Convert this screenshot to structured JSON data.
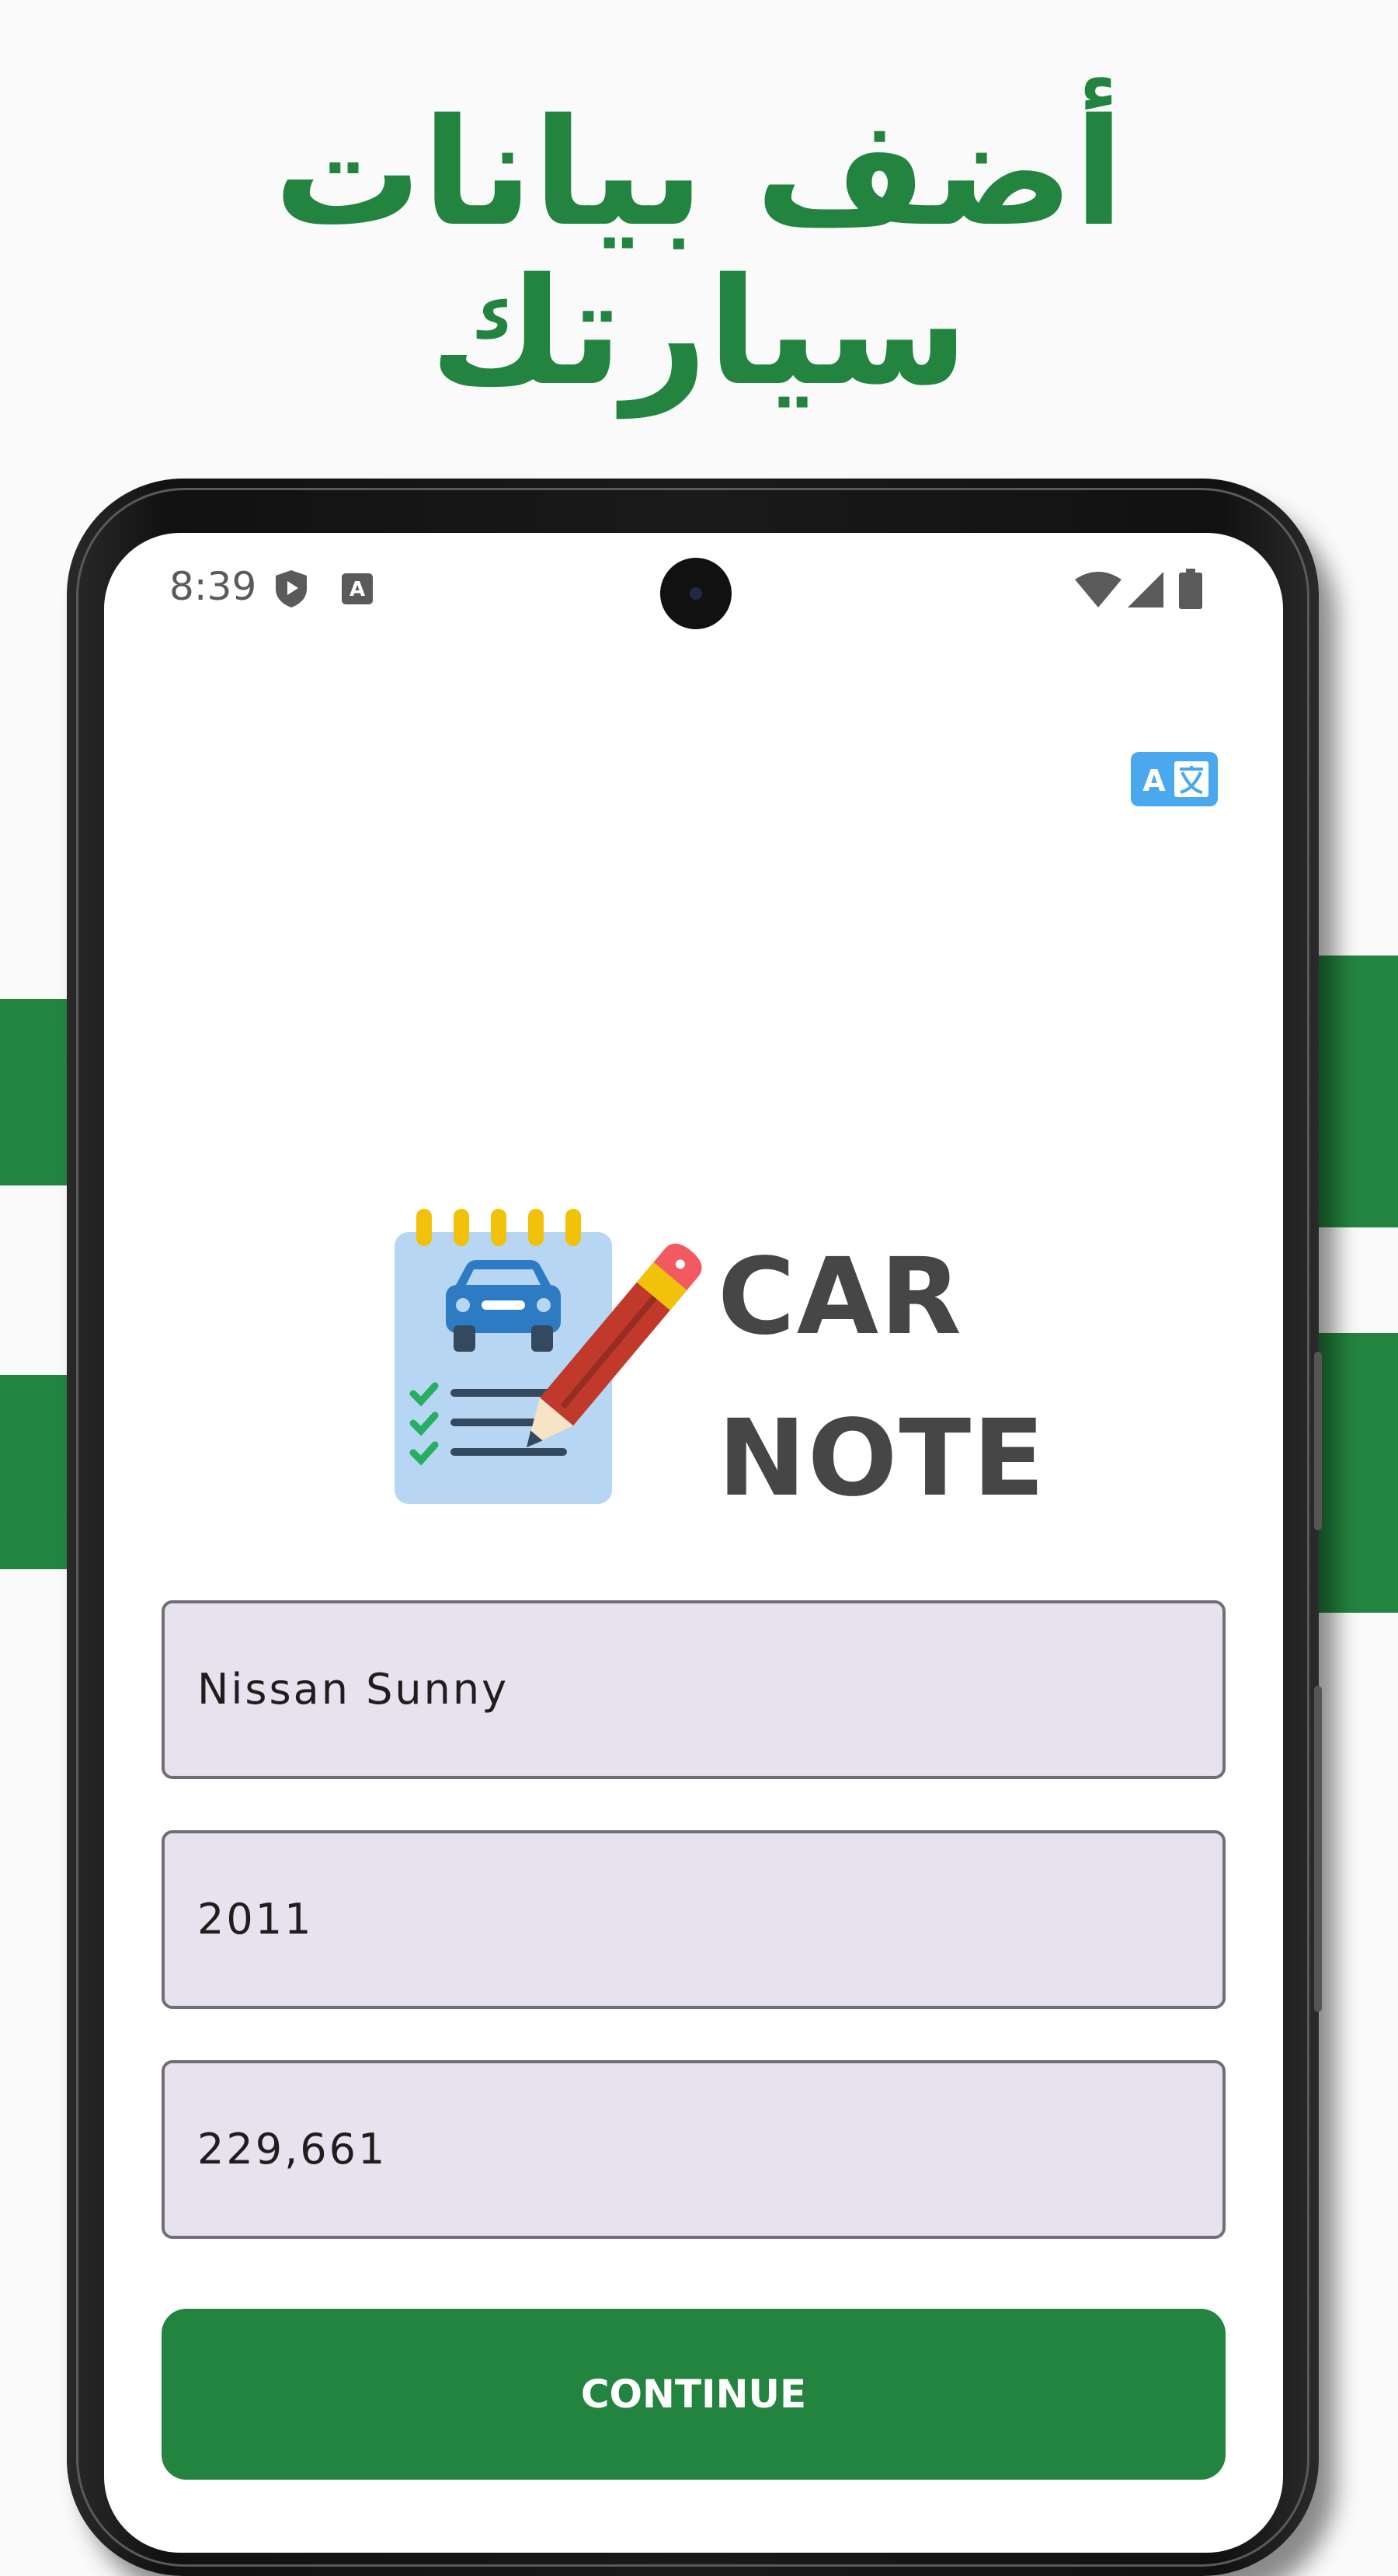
{
  "promo": {
    "headline_line1": "أضف بيانات",
    "headline_line2": "سيارتك"
  },
  "colors": {
    "brand_green": "#23843f",
    "field_fill": "#e8e1ee",
    "translate_blue": "#4aa8ee"
  },
  "status_bar": {
    "time": "8:39",
    "icons": [
      "shield-play-icon",
      "font-notification-icon",
      "wifi-icon",
      "cellular-signal-icon",
      "battery-icon"
    ]
  },
  "toolbar": {
    "translate_icon": "translate-icon"
  },
  "logo": {
    "line1": "CAR",
    "line2": "NOTE",
    "icon": "notepad-car-pencil-icon"
  },
  "form": {
    "car_model": "Nissan Sunny",
    "year": "2011",
    "mileage": "229,661"
  },
  "actions": {
    "continue_label": "CONTINUE"
  }
}
